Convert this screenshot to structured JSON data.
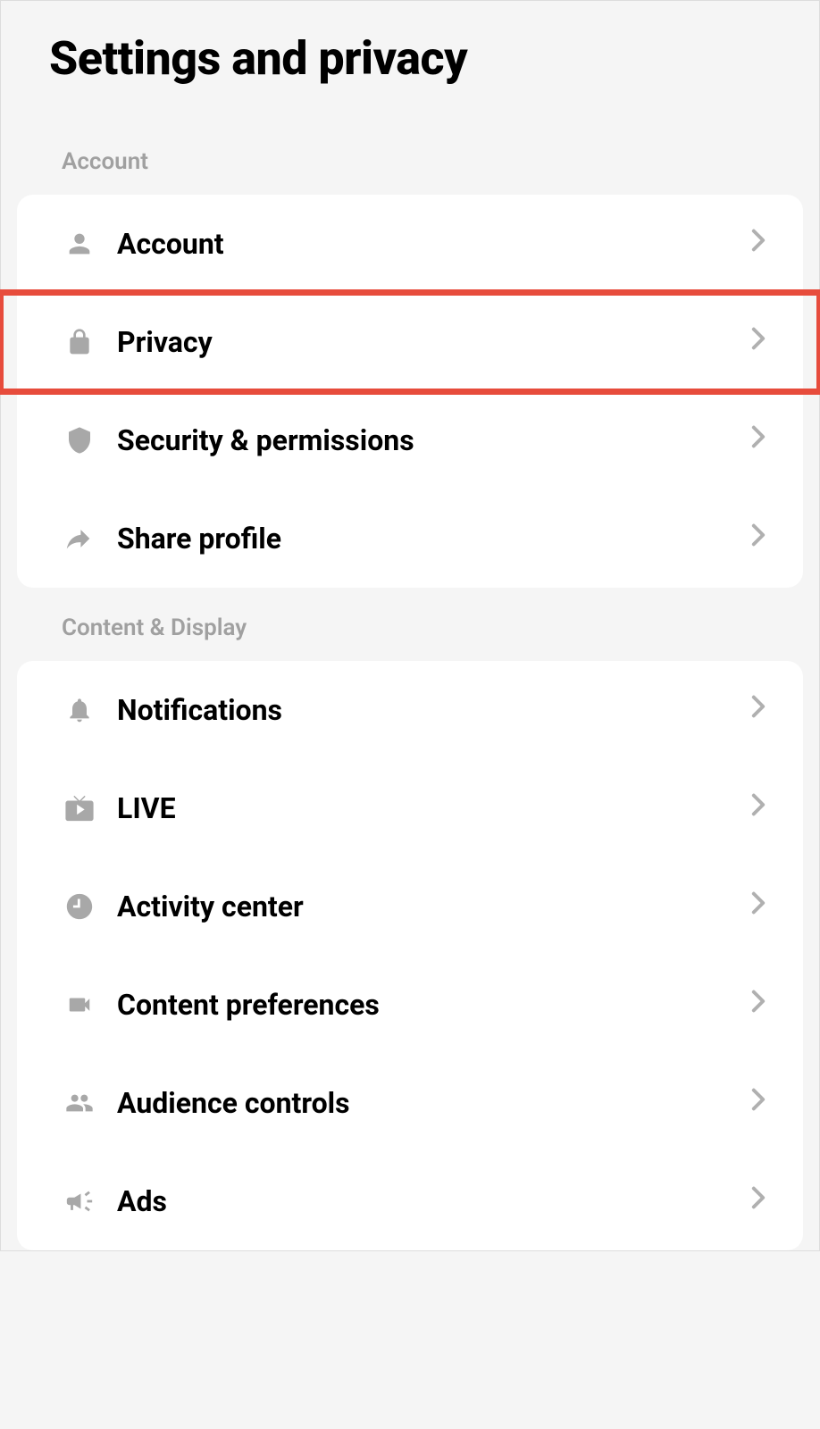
{
  "title": "Settings and privacy",
  "sections": [
    {
      "header": "Account",
      "items": [
        {
          "icon": "person",
          "label": "Account",
          "highlighted": false
        },
        {
          "icon": "lock",
          "label": "Privacy",
          "highlighted": true
        },
        {
          "icon": "shield",
          "label": "Security & permissions",
          "highlighted": false
        },
        {
          "icon": "share",
          "label": "Share profile",
          "highlighted": false
        }
      ]
    },
    {
      "header": "Content & Display",
      "items": [
        {
          "icon": "bell",
          "label": "Notifications",
          "highlighted": false
        },
        {
          "icon": "tv",
          "label": "LIVE",
          "highlighted": false
        },
        {
          "icon": "clock",
          "label": "Activity center",
          "highlighted": false
        },
        {
          "icon": "video",
          "label": "Content preferences",
          "highlighted": false
        },
        {
          "icon": "people",
          "label": "Audience controls",
          "highlighted": false
        },
        {
          "icon": "megaphone",
          "label": "Ads",
          "highlighted": false
        }
      ]
    }
  ]
}
